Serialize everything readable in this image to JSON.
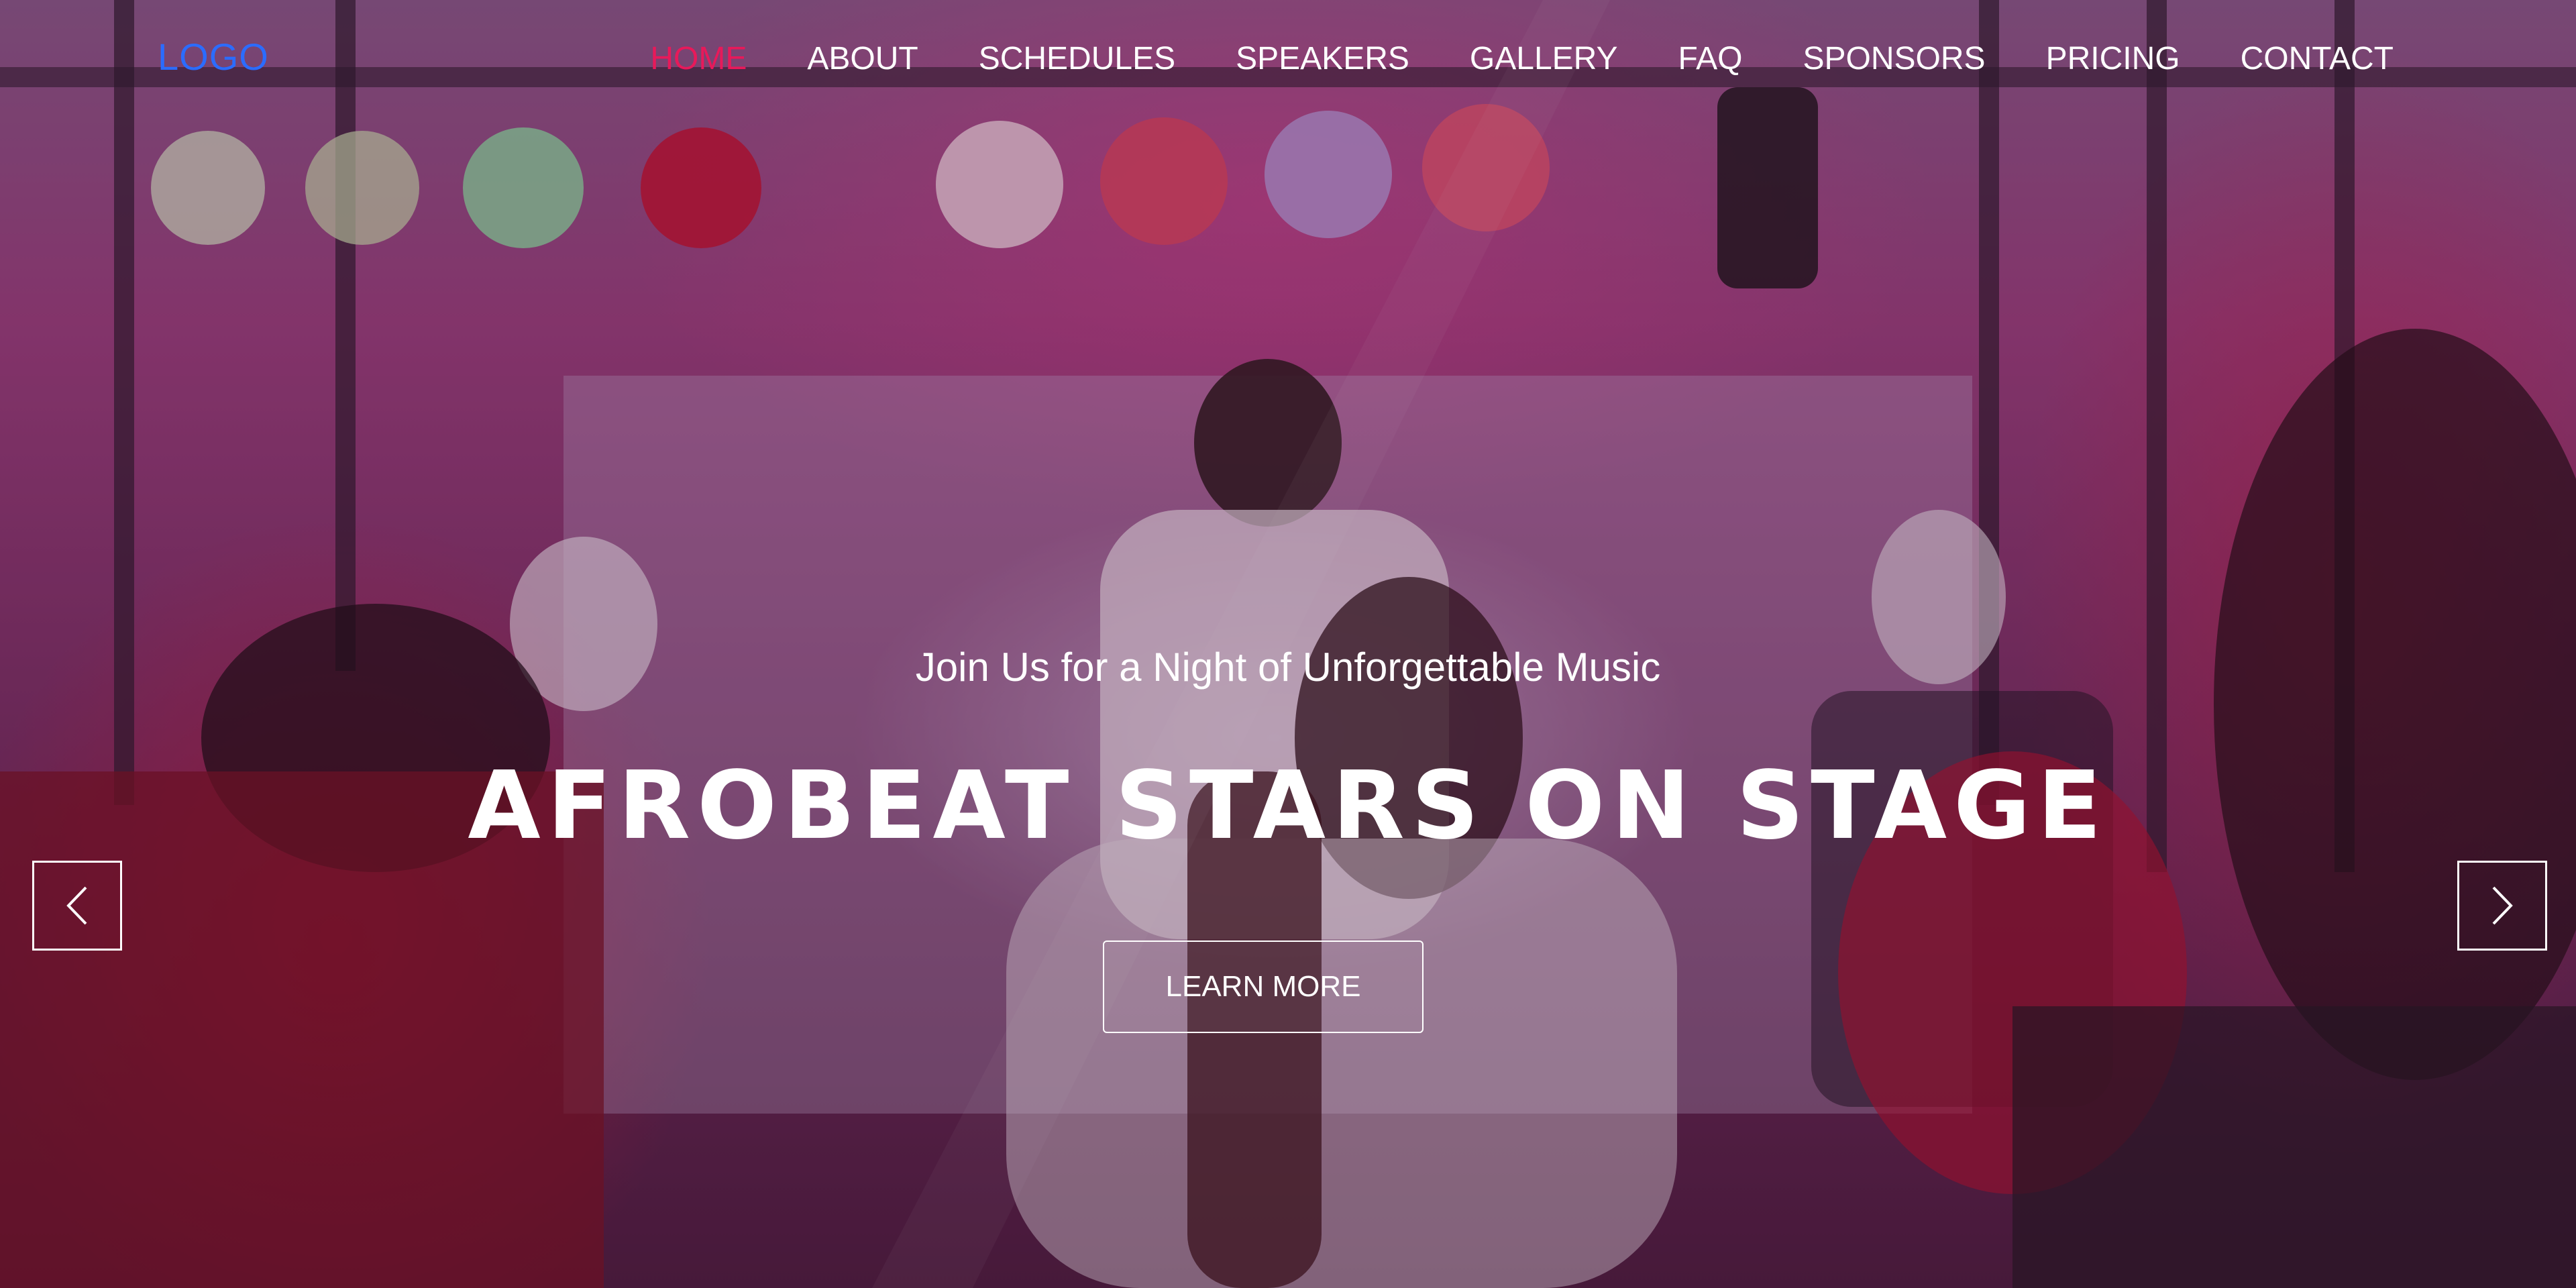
{
  "nav": {
    "logo": "LOGO",
    "items": [
      {
        "label": "HOME",
        "active": true
      },
      {
        "label": "ABOUT"
      },
      {
        "label": "SCHEDULES"
      },
      {
        "label": "SPEAKERS"
      },
      {
        "label": "GALLERY"
      },
      {
        "label": "FAQ"
      },
      {
        "label": "SPONSORS"
      },
      {
        "label": "PRICING"
      },
      {
        "label": "CONTACT"
      }
    ]
  },
  "hero": {
    "subtitle": "Join Us for a Night of Unforgettable Music",
    "title": "AFROBEAT STARS ON STAGE",
    "cta_label": "LEARN MORE",
    "prev_icon": "chevron-left-icon",
    "next_icon": "chevron-right-icon"
  },
  "colors": {
    "logo": "#2b6cff",
    "active_nav": "#e8195a",
    "text": "#ffffff"
  }
}
